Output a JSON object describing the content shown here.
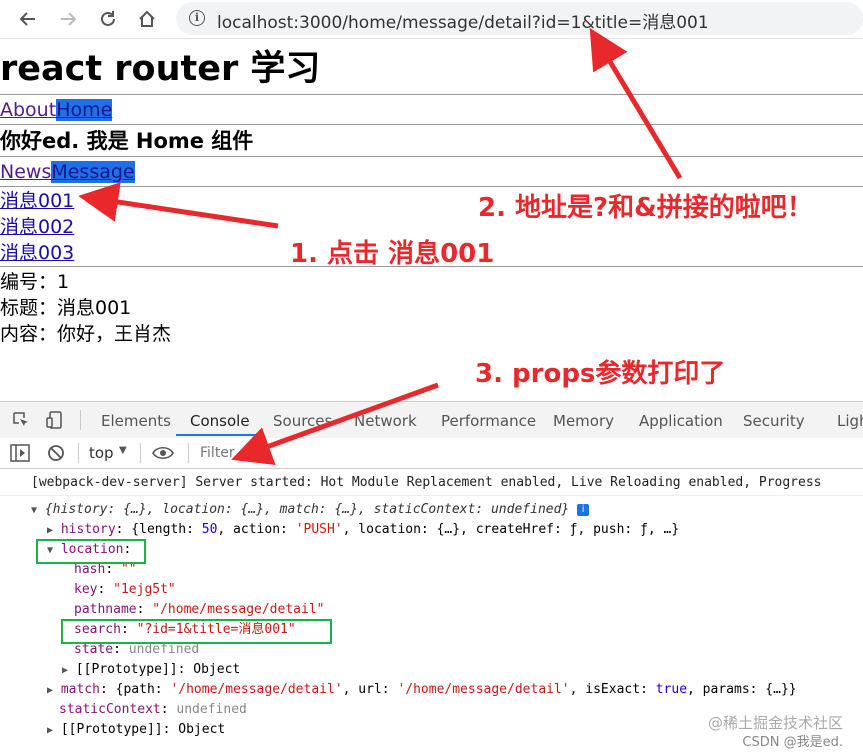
{
  "browser": {
    "url": "localhost:3000/home/message/detail?id=1&title=消息001"
  },
  "page": {
    "title": "react router 学习",
    "nav1": [
      "About",
      "Home"
    ],
    "greeting": "你好ed. 我是 Home 组件",
    "nav2": [
      "News",
      "Message"
    ],
    "messages": [
      "消息001",
      "消息002",
      "消息003"
    ],
    "detail": [
      "编号：1",
      "标题：消息001",
      "内容：你好，王肖杰"
    ]
  },
  "annotations": {
    "a1": "1. 点击 消息001",
    "a2": "2. 地址是?和&拼接的啦吧！",
    "a3": "3. props参数打印了"
  },
  "devtools": {
    "tabs": [
      "Elements",
      "Console",
      "Sources",
      "Network",
      "Performance",
      "Memory",
      "Application",
      "Security",
      "Ligh"
    ],
    "context": "top",
    "filter_placeholder": "Filter"
  },
  "console": {
    "server_msg": "[webpack-dev-server] Server started: Hot Module Replacement enabled, Live Reloading enabled, Progress",
    "obj_preview": "{history: {…}, location: {…}, match: {…}, staticContext: undefined}",
    "history_key": "history",
    "history_val_a": ": {length: ",
    "history_len": "50",
    "history_val_b": ", action: ",
    "history_action": "'PUSH'",
    "history_val_c": ", location: {…}, createHref: ƒ, push: ƒ, …}",
    "location_key": "location",
    "hash_key": "hash",
    "hash_val": "\"\"",
    "key_key": "key",
    "key_val": "\"1ejg5t\"",
    "pathname_key": "pathname",
    "pathname_val": "\"/home/message/detail\"",
    "search_key": "search",
    "search_val": "\"?id=1&title=消息001\"",
    "state_key": "state",
    "state_val": "undefined",
    "proto1": "[[Prototype]]: Object",
    "match_key": "match",
    "match_a": ": {path: ",
    "match_path": "'/home/message/detail'",
    "match_b": ", url: ",
    "match_url": "'/home/message/detail'",
    "match_c": ", isExact: ",
    "match_exact": "true",
    "match_d": ", params: {…}}",
    "static_key": "staticContext",
    "static_val": "undefined",
    "proto2": "[[Prototype]]: Object"
  },
  "watermark": {
    "juejin": "@稀土掘金技术社区",
    "csdn": "CSDN @我是ed."
  },
  "colors": {
    "annotation": "#e8282b",
    "highlight_box": "#1bb24a",
    "active_link": "#1e6fe8",
    "tab_underline": "#1a73e8"
  }
}
